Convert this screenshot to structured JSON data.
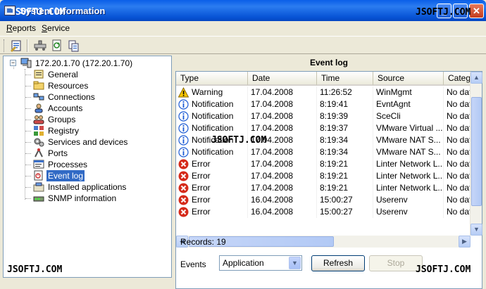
{
  "window": {
    "title": "System information",
    "watermark": "JSOFTJ.COM",
    "minimize_glyph": "_",
    "maximize_glyph": "□",
    "close_glyph": "✕"
  },
  "menu": {
    "reports": "Reports",
    "service": "Service"
  },
  "toolbar": {
    "icons": [
      "report-icon",
      "network-icon",
      "refresh-icon",
      "copy-icon"
    ]
  },
  "tree": {
    "root": "172.20.1.70 (172.20.1.70)",
    "expander": "−",
    "items": [
      {
        "label": "General",
        "icon": "general-icon"
      },
      {
        "label": "Resources",
        "icon": "resources-icon"
      },
      {
        "label": "Connections",
        "icon": "connections-icon"
      },
      {
        "label": "Accounts",
        "icon": "accounts-icon"
      },
      {
        "label": "Groups",
        "icon": "groups-icon"
      },
      {
        "label": "Registry",
        "icon": "registry-icon"
      },
      {
        "label": "Services and devices",
        "icon": "services-icon"
      },
      {
        "label": "Ports",
        "icon": "ports-icon"
      },
      {
        "label": "Processes",
        "icon": "processes-icon"
      },
      {
        "label": "Event log",
        "icon": "event-log-icon"
      },
      {
        "label": "Installed applications",
        "icon": "applications-icon"
      },
      {
        "label": "SNMP information",
        "icon": "snmp-icon"
      }
    ],
    "selected": "Event log"
  },
  "event_log": {
    "title": "Event log",
    "columns": [
      "Type",
      "Date",
      "Time",
      "Source",
      "Categ"
    ],
    "rows": [
      {
        "type": "Warning",
        "icon": "warning-icon",
        "date": "17.04.2008",
        "time": "11:26:52",
        "source": "WinMgmt",
        "category": "No dat"
      },
      {
        "type": "Notification",
        "icon": "info-icon",
        "date": "17.04.2008",
        "time": "8:19:41",
        "source": "EvntAgnt",
        "category": "No dat"
      },
      {
        "type": "Notification",
        "icon": "info-icon",
        "date": "17.04.2008",
        "time": "8:19:39",
        "source": "SceCli",
        "category": "No dat"
      },
      {
        "type": "Notification",
        "icon": "info-icon",
        "date": "17.04.2008",
        "time": "8:19:37",
        "source": "VMware Virtual ...",
        "category": "No dat"
      },
      {
        "type": "Notification",
        "icon": "info-icon",
        "date": "17.04.2008",
        "time": "8:19:34",
        "source": "VMware NAT S...",
        "category": "No dat"
      },
      {
        "type": "Notification",
        "icon": "info-icon",
        "date": "17.04.2008",
        "time": "8:19:34",
        "source": "VMware NAT S...",
        "category": "No dat"
      },
      {
        "type": "Error",
        "icon": "error-icon",
        "date": "17.04.2008",
        "time": "8:19:21",
        "source": "Linter Network L...",
        "category": "No dat"
      },
      {
        "type": "Error",
        "icon": "error-icon",
        "date": "17.04.2008",
        "time": "8:19:21",
        "source": "Linter Network L...",
        "category": "No dat"
      },
      {
        "type": "Error",
        "icon": "error-icon",
        "date": "17.04.2008",
        "time": "8:19:21",
        "source": "Linter Network L...",
        "category": "No dat"
      },
      {
        "type": "Error",
        "icon": "error-icon",
        "date": "16.04.2008",
        "time": "15:00:27",
        "source": "Userenv",
        "category": "No dat"
      },
      {
        "type": "Error",
        "icon": "error-icon",
        "date": "16.04.2008",
        "time": "15:00:27",
        "source": "Userenv",
        "category": "No dat"
      }
    ],
    "records": "Records: 19"
  },
  "controls": {
    "events_label": "Events",
    "events_value": "Application",
    "refresh": "Refresh",
    "stop": "Stop"
  },
  "colors": {
    "title_bar": "#0a5ee8",
    "selection": "#316ac5",
    "error": "#d52a1a",
    "warning": "#f7c600",
    "info": "#1c5bd4"
  }
}
